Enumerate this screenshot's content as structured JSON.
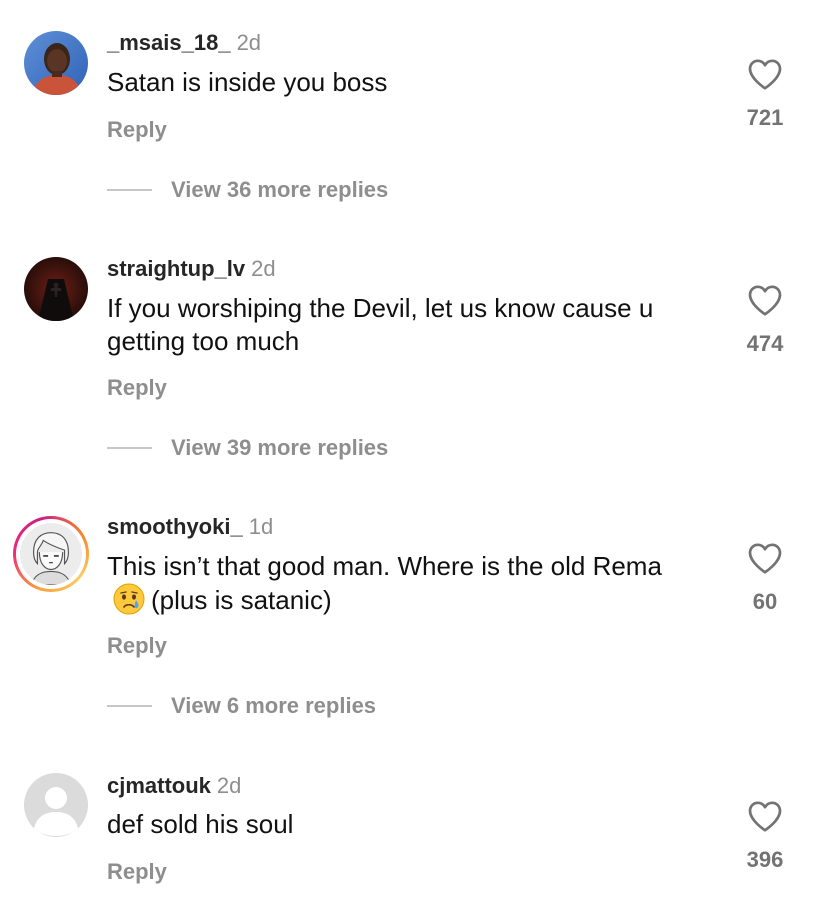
{
  "comments": [
    {
      "username": "_msais_18_",
      "time": "2d",
      "text": "Satan is inside you boss",
      "reply_label": "Reply",
      "likes": "721",
      "replies_label": "View 36 more replies",
      "avatar": "person-photo"
    },
    {
      "username": "straightup_lv",
      "time": "2d",
      "text": "If you worshiping the Devil, let us know cause u getting too much",
      "reply_label": "Reply",
      "likes": "474",
      "replies_label": "View 39 more replies",
      "avatar": "dark-photo"
    },
    {
      "username": "smoothyoki_",
      "time": "1d",
      "text_before_emoji": "This isn’t that good man. Where is the old Rema",
      "emoji": "crying-face-emoji",
      "text_after_emoji": "(plus is satanic)",
      "reply_label": "Reply",
      "likes": "60",
      "replies_label": "View 6 more replies",
      "avatar": "anime-sketch-with-story-ring"
    },
    {
      "username": "cjmattouk",
      "time": "2d",
      "text": "def sold his soul",
      "reply_label": "Reply",
      "likes": "396",
      "avatar": "default-profile"
    }
  ],
  "icons": {
    "like": "heart-outline-icon"
  },
  "colors": {
    "username": "#262626",
    "secondary": "#8e8e8e",
    "like_count": "#737373",
    "story_ring_start": "#f9a13a",
    "story_ring_end": "#ee2a7b"
  }
}
